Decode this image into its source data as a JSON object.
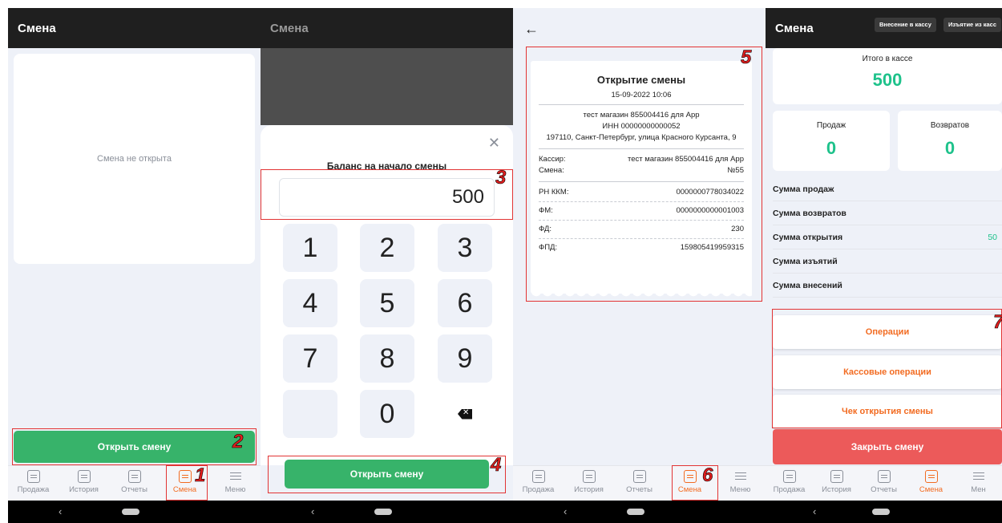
{
  "nav": [
    "Продажа",
    "История",
    "Отчеты",
    "Смена",
    "Меню"
  ],
  "screen1": {
    "title": "Смена",
    "empty_text": "Смена не открыта",
    "open_button": "Открыть смену",
    "markers": [
      "1",
      "2"
    ]
  },
  "screen2": {
    "title": "Смена",
    "close_icon": "close-icon",
    "balance_label": "Баланс на начало смены",
    "amount": "500",
    "keys": [
      "1",
      "2",
      "3",
      "4",
      "5",
      "6",
      "7",
      "8",
      "9",
      "",
      "0",
      "backspace"
    ],
    "open_button": "Открыть смену",
    "markers": [
      "3",
      "4"
    ]
  },
  "screen3": {
    "back_icon": "arrow-left-icon",
    "receipt": {
      "title": "Открытие смены",
      "date": "15-09-2022 10:06",
      "shop": "тест магазин 855004416 для App",
      "inn": "ИНН 00000000000052",
      "address": "197110, Санкт-Петербург, улица Красного Курсанта, 9",
      "rows1": [
        {
          "k": "Кассир:",
          "v": "тест магазин 855004416 для App"
        },
        {
          "k": "Смена:",
          "v": "№55"
        }
      ],
      "rows2": [
        {
          "k": "РН ККМ:",
          "v": "0000000778034022"
        },
        {
          "k": "ФМ:",
          "v": "0000000000001003"
        },
        {
          "k": "ФД:",
          "v": "230"
        },
        {
          "k": "ФПД:",
          "v": "159805419959315"
        }
      ]
    },
    "markers": [
      "5",
      "6"
    ]
  },
  "screen4": {
    "title": "Смена",
    "deposit_button": "Внесение в кассу",
    "withdraw_button": "Изъятие из касс",
    "total_label": "Итого в кассе",
    "total_value": "500",
    "sales_label": "Продаж",
    "sales_value": "0",
    "returns_label": "Возвратов",
    "returns_value": "0",
    "sums": [
      {
        "label": "Сумма продаж",
        "value": ""
      },
      {
        "label": "Сумма возвратов",
        "value": ""
      },
      {
        "label": "Сумма открытия",
        "value": "50"
      },
      {
        "label": "Сумма изъятий",
        "value": ""
      },
      {
        "label": "Сумма внесений",
        "value": ""
      }
    ],
    "operations": [
      "Операции",
      "Кассовые операции",
      "Чек открытия смены"
    ],
    "close_button": "Закрыть смену",
    "nav_last": "Мен",
    "markers": [
      "7"
    ]
  },
  "colors": {
    "accent": "#f26b21",
    "green": "#37b36a",
    "teal": "#1ec28b",
    "danger": "#ec5a5a",
    "marker": "#e01e1e"
  }
}
